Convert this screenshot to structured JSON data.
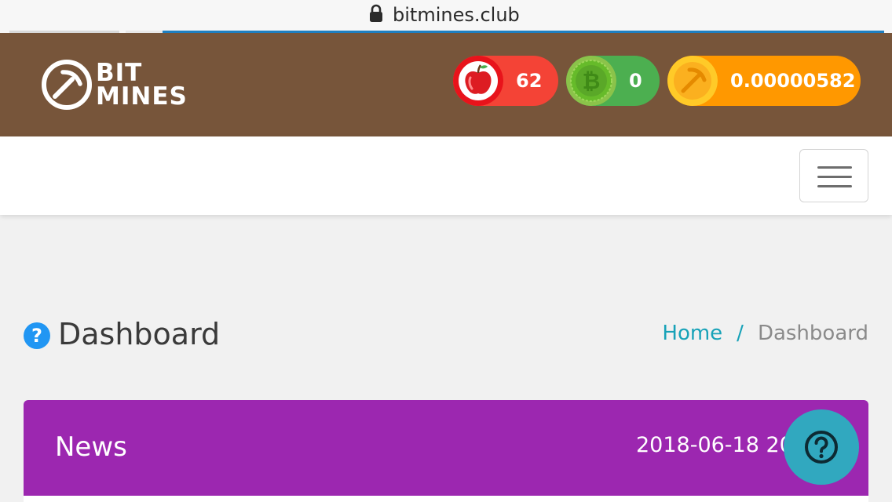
{
  "browser": {
    "url": "bitmines.club",
    "icon": "lock-icon"
  },
  "header": {
    "logo_top": "BIT",
    "logo_bottom": "MINES",
    "logo_icon": "pickaxe-icon",
    "balances": [
      {
        "name": "apples",
        "icon": "apple-icon",
        "value": "62",
        "color": "#f44336"
      },
      {
        "name": "bitcoin",
        "icon": "bitcoin-icon",
        "value": "0",
        "color": "#4caf50"
      },
      {
        "name": "mined",
        "icon": "pickaxe-coin-icon",
        "value": "0.00000582",
        "color": "#ff9800"
      }
    ]
  },
  "nav": {
    "toggler_icon": "hamburger-menu-icon"
  },
  "page": {
    "title": "Dashboard",
    "title_icon": "question-circle-icon",
    "breadcrumb": {
      "home": "Home",
      "separator": "/",
      "current": "Dashboard"
    }
  },
  "news": {
    "title": "News",
    "date": "2018-06-18 20:",
    "color": "#9c27b0"
  },
  "help_button": {
    "icon": "question-circle-icon",
    "color": "#31a8bf"
  }
}
